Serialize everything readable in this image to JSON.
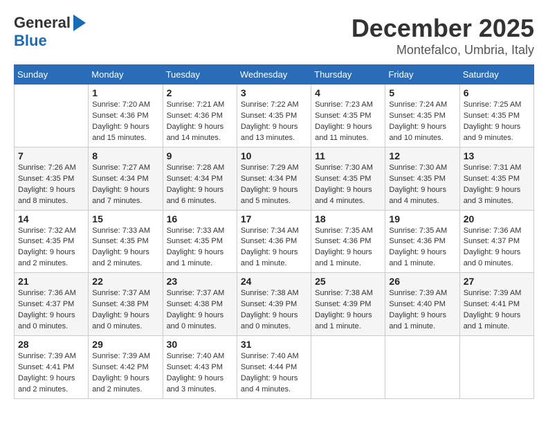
{
  "logo": {
    "general": "General",
    "blue": "Blue"
  },
  "title": {
    "month": "December 2025",
    "location": "Montefalco, Umbria, Italy"
  },
  "days_of_week": [
    "Sunday",
    "Monday",
    "Tuesday",
    "Wednesday",
    "Thursday",
    "Friday",
    "Saturday"
  ],
  "weeks": [
    [
      {
        "day": "",
        "info": ""
      },
      {
        "day": "1",
        "info": "Sunrise: 7:20 AM\nSunset: 4:36 PM\nDaylight: 9 hours\nand 15 minutes."
      },
      {
        "day": "2",
        "info": "Sunrise: 7:21 AM\nSunset: 4:36 PM\nDaylight: 9 hours\nand 14 minutes."
      },
      {
        "day": "3",
        "info": "Sunrise: 7:22 AM\nSunset: 4:35 PM\nDaylight: 9 hours\nand 13 minutes."
      },
      {
        "day": "4",
        "info": "Sunrise: 7:23 AM\nSunset: 4:35 PM\nDaylight: 9 hours\nand 11 minutes."
      },
      {
        "day": "5",
        "info": "Sunrise: 7:24 AM\nSunset: 4:35 PM\nDaylight: 9 hours\nand 10 minutes."
      },
      {
        "day": "6",
        "info": "Sunrise: 7:25 AM\nSunset: 4:35 PM\nDaylight: 9 hours\nand 9 minutes."
      }
    ],
    [
      {
        "day": "7",
        "info": "Sunrise: 7:26 AM\nSunset: 4:35 PM\nDaylight: 9 hours\nand 8 minutes."
      },
      {
        "day": "8",
        "info": "Sunrise: 7:27 AM\nSunset: 4:34 PM\nDaylight: 9 hours\nand 7 minutes."
      },
      {
        "day": "9",
        "info": "Sunrise: 7:28 AM\nSunset: 4:34 PM\nDaylight: 9 hours\nand 6 minutes."
      },
      {
        "day": "10",
        "info": "Sunrise: 7:29 AM\nSunset: 4:34 PM\nDaylight: 9 hours\nand 5 minutes."
      },
      {
        "day": "11",
        "info": "Sunrise: 7:30 AM\nSunset: 4:35 PM\nDaylight: 9 hours\nand 4 minutes."
      },
      {
        "day": "12",
        "info": "Sunrise: 7:30 AM\nSunset: 4:35 PM\nDaylight: 9 hours\nand 4 minutes."
      },
      {
        "day": "13",
        "info": "Sunrise: 7:31 AM\nSunset: 4:35 PM\nDaylight: 9 hours\nand 3 minutes."
      }
    ],
    [
      {
        "day": "14",
        "info": "Sunrise: 7:32 AM\nSunset: 4:35 PM\nDaylight: 9 hours\nand 2 minutes."
      },
      {
        "day": "15",
        "info": "Sunrise: 7:33 AM\nSunset: 4:35 PM\nDaylight: 9 hours\nand 2 minutes."
      },
      {
        "day": "16",
        "info": "Sunrise: 7:33 AM\nSunset: 4:35 PM\nDaylight: 9 hours\nand 1 minute."
      },
      {
        "day": "17",
        "info": "Sunrise: 7:34 AM\nSunset: 4:36 PM\nDaylight: 9 hours\nand 1 minute."
      },
      {
        "day": "18",
        "info": "Sunrise: 7:35 AM\nSunset: 4:36 PM\nDaylight: 9 hours\nand 1 minute."
      },
      {
        "day": "19",
        "info": "Sunrise: 7:35 AM\nSunset: 4:36 PM\nDaylight: 9 hours\nand 1 minute."
      },
      {
        "day": "20",
        "info": "Sunrise: 7:36 AM\nSunset: 4:37 PM\nDaylight: 9 hours\nand 0 minutes."
      }
    ],
    [
      {
        "day": "21",
        "info": "Sunrise: 7:36 AM\nSunset: 4:37 PM\nDaylight: 9 hours\nand 0 minutes."
      },
      {
        "day": "22",
        "info": "Sunrise: 7:37 AM\nSunset: 4:38 PM\nDaylight: 9 hours\nand 0 minutes."
      },
      {
        "day": "23",
        "info": "Sunrise: 7:37 AM\nSunset: 4:38 PM\nDaylight: 9 hours\nand 0 minutes."
      },
      {
        "day": "24",
        "info": "Sunrise: 7:38 AM\nSunset: 4:39 PM\nDaylight: 9 hours\nand 0 minutes."
      },
      {
        "day": "25",
        "info": "Sunrise: 7:38 AM\nSunset: 4:39 PM\nDaylight: 9 hours\nand 1 minute."
      },
      {
        "day": "26",
        "info": "Sunrise: 7:39 AM\nSunset: 4:40 PM\nDaylight: 9 hours\nand 1 minute."
      },
      {
        "day": "27",
        "info": "Sunrise: 7:39 AM\nSunset: 4:41 PM\nDaylight: 9 hours\nand 1 minute."
      }
    ],
    [
      {
        "day": "28",
        "info": "Sunrise: 7:39 AM\nSunset: 4:41 PM\nDaylight: 9 hours\nand 2 minutes."
      },
      {
        "day": "29",
        "info": "Sunrise: 7:39 AM\nSunset: 4:42 PM\nDaylight: 9 hours\nand 2 minutes."
      },
      {
        "day": "30",
        "info": "Sunrise: 7:40 AM\nSunset: 4:43 PM\nDaylight: 9 hours\nand 3 minutes."
      },
      {
        "day": "31",
        "info": "Sunrise: 7:40 AM\nSunset: 4:44 PM\nDaylight: 9 hours\nand 4 minutes."
      },
      {
        "day": "",
        "info": ""
      },
      {
        "day": "",
        "info": ""
      },
      {
        "day": "",
        "info": ""
      }
    ]
  ]
}
